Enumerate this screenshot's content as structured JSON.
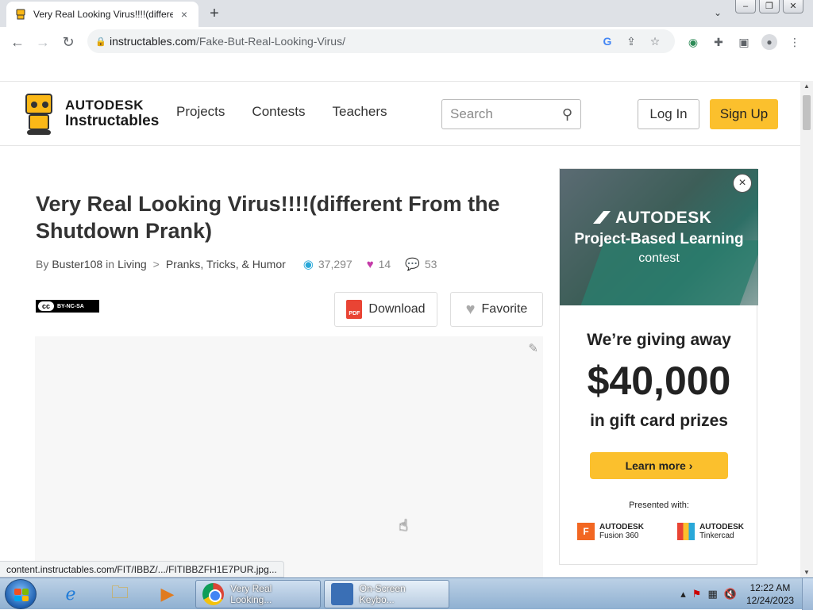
{
  "browser": {
    "tab_title": "Very Real Looking Virus!!!!(different From the Shutdown Prank)",
    "tab_close": "×",
    "new_tab": "+",
    "url_domain": "instructables.com",
    "url_path": "/Fake-But-Real-Looking-Virus/",
    "google_g": "G"
  },
  "site": {
    "logo_line1": "AUTODESK",
    "logo_line2": "Instructables",
    "nav": [
      "Projects",
      "Contests",
      "Teachers"
    ],
    "search_placeholder": "Search",
    "login_label": "Log In",
    "signup_label": "Sign Up"
  },
  "article": {
    "title": "Very Real Looking Virus!!!!(different From the Shutdown Prank)",
    "by_label": "By",
    "author": "Buster108",
    "in_label": "in",
    "category": "Living",
    "breadcrumb_sep": ">",
    "subcategory": "Pranks, Tricks, & Humor",
    "views": "37,297",
    "favorites": "14",
    "comments": "53",
    "license_cc": "cc",
    "license_text": "BY-NC-SA",
    "pdf_label": "PDF",
    "download_label": "Download",
    "favorite_label": "Favorite"
  },
  "ad": {
    "close": "×",
    "brand": "AUTODESK",
    "hero_line2": "Project-Based Learning",
    "hero_line3": "contest",
    "giving_away": "We’re giving away",
    "amount": "$40,000",
    "prizes": "in gift card prizes",
    "learn_more": "Learn more ›",
    "presented_with": "Presented with:",
    "sponsors": [
      {
        "brand": "AUTODESK",
        "product": "Fusion 360",
        "mark": "F"
      },
      {
        "brand": "AUTODESK",
        "product": "Tinkercad",
        "mark": ""
      }
    ]
  },
  "status_url": "content.instructables.com/FIT/IBBZ/.../FITIBBZFH1E7PUR.jpg...",
  "taskbar": {
    "tasks": [
      {
        "label": "Very Real Looking..."
      },
      {
        "label": "On-Screen Keybo..."
      }
    ],
    "time": "12:22 AM",
    "date": "12/24/2023"
  },
  "colors": {
    "accent_yellow": "#fbc02d",
    "views_icon": "#29a8d9",
    "likes_icon": "#c43ba8",
    "comments_icon": "#58b742"
  }
}
